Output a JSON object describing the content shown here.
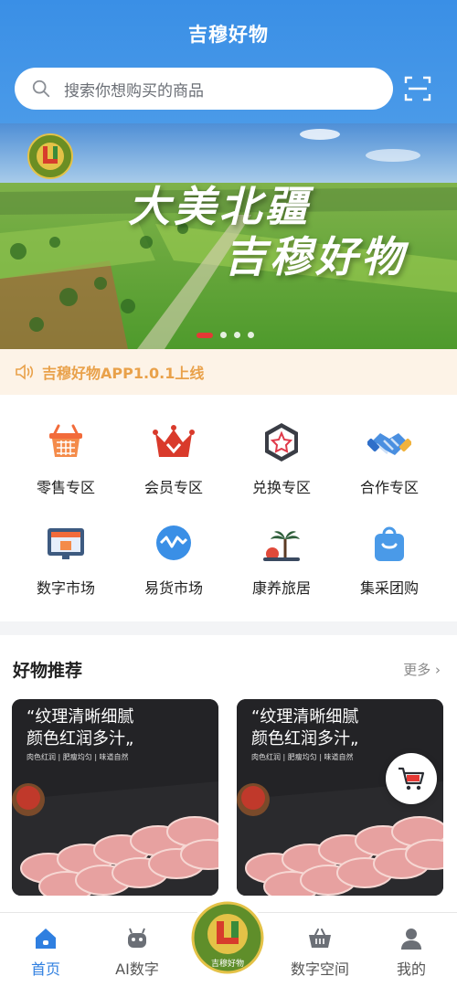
{
  "header": {
    "title": "吉穆好物"
  },
  "search": {
    "placeholder": "搜索你想购买的商品"
  },
  "banner": {
    "line1": "大美北疆",
    "line2": "吉穆好物",
    "slides": 4,
    "active_slide": 1
  },
  "notice": {
    "text": "吉穆好物APP1.0.1上线"
  },
  "categories": [
    {
      "label": "零售专区",
      "icon": "basket-icon"
    },
    {
      "label": "会员专区",
      "icon": "crown-icon"
    },
    {
      "label": "兑换专区",
      "icon": "star-badge-icon"
    },
    {
      "label": "合作专区",
      "icon": "handshake-icon"
    },
    {
      "label": "数字市场",
      "icon": "monitor-store-icon"
    },
    {
      "label": "易货市场",
      "icon": "exchange-icon"
    },
    {
      "label": "康养旅居",
      "icon": "palm-island-icon"
    },
    {
      "label": "集采团购",
      "icon": "shopping-bag-icon"
    }
  ],
  "recommend": {
    "title": "好物推荐",
    "more": "更多",
    "cards": [
      {
        "line1": "“纹理清晰细腻",
        "line2": "颜色红润多汁„",
        "tags": "肉色红润 | 肥瘦均匀 | 味道自然"
      },
      {
        "line1": "“纹理清晰细腻",
        "line2": "颜色红润多汁„",
        "tags": "肉色红润 | 肥瘦均匀 | 味道自然"
      }
    ]
  },
  "tabbar": {
    "items": [
      {
        "label": "首页",
        "active": true
      },
      {
        "label": "AI数字",
        "active": false
      },
      {
        "label": "数字空间",
        "active": false
      },
      {
        "label": "我的",
        "active": false
      }
    ],
    "center_logo": "吉穆好物"
  },
  "colors": {
    "primary": "#3a8fe6",
    "notice": "#e9a14a",
    "accent": "#e53935",
    "active_tab": "#2f7fe0"
  }
}
